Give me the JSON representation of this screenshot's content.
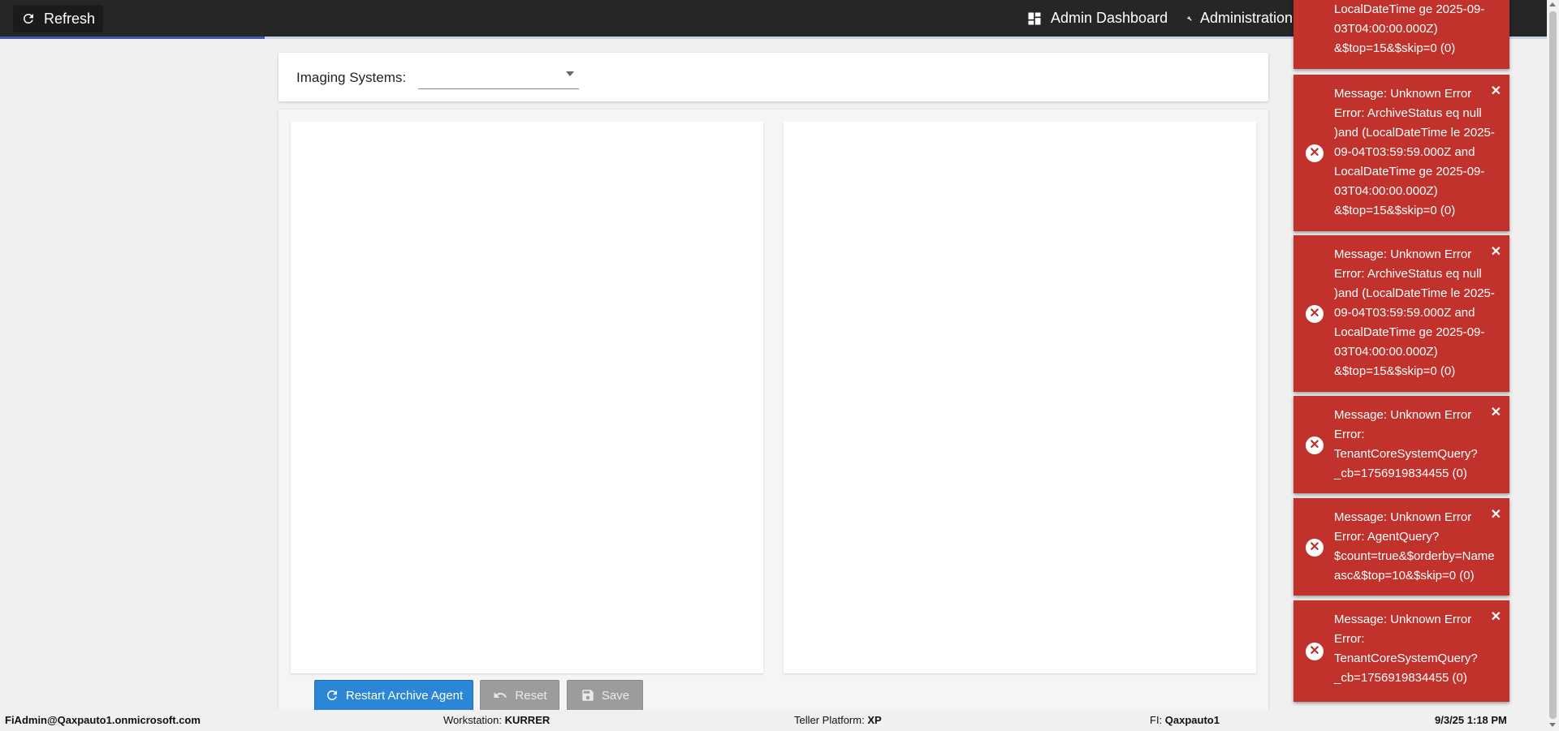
{
  "topbar": {
    "refresh_label": "Refresh",
    "nav": {
      "dashboard_label": "Admin Dashboard",
      "administration_label": "Administration"
    },
    "progress_percent": 17
  },
  "filter": {
    "imaging_systems_label": "Imaging Systems:",
    "imaging_systems_value": ""
  },
  "actions": {
    "restart_label": "Restart Archive Agent",
    "reset_label": "Reset",
    "save_label": "Save"
  },
  "status_bar": {
    "user": "FiAdmin@Qaxpauto1.onmicrosoft.com",
    "workstation_label": "Workstation:",
    "workstation_value": "KURRER",
    "teller_platform_label": "Teller Platform:",
    "teller_platform_value": "XP",
    "fi_label": "FI:",
    "fi_value": "Qaxpauto1",
    "datetime": "9/3/25 1:18 PM"
  },
  "toasts": [
    {
      "message": "LocalDateTime ge 2025-09-03T04:00:00.000Z) &$top=15&$skip=0 (0)"
    },
    {
      "message": "Message: Unknown Error Error: ArchiveStatus eq null )and (LocalDateTime le 2025-09-04T03:59:59.000Z and LocalDateTime ge 2025-09-03T04:00:00.000Z) &$top=15&$skip=0 (0)"
    },
    {
      "message": "Message: Unknown Error Error: ArchiveStatus eq null )and (LocalDateTime le 2025-09-04T03:59:59.000Z and LocalDateTime ge 2025-09-03T04:00:00.000Z) &$top=15&$skip=0 (0)"
    },
    {
      "message": "Message: Unknown Error Error: TenantCoreSystemQuery?_cb=1756919834455 (0)"
    },
    {
      "message": "Message: Unknown Error Error: AgentQuery?$count=true&$orderby=Name asc&$top=10&$skip=0 (0)"
    },
    {
      "message": "Message: Unknown Error Error: TenantCoreSystemQuery?_cb=1756919834455 (0)"
    }
  ],
  "colors": {
    "topbar": "#262626",
    "toast_error": "#c0322b",
    "primary_button": "#2b86d8",
    "disabled_button": "#9c9c9c"
  },
  "icons": {
    "refresh": "refresh-icon",
    "dashboard": "dashboard-icon",
    "administration": "wrench-icon",
    "error": "error-circle-icon",
    "close": "close-icon",
    "reset": "undo-icon",
    "save": "floppy-icon"
  }
}
